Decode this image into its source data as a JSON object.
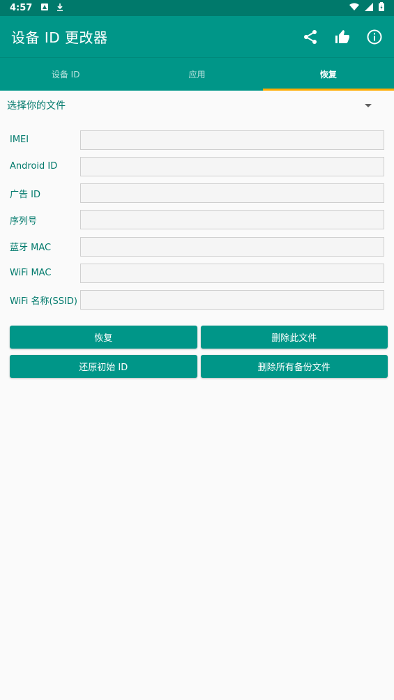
{
  "status_bar": {
    "time": "4:57"
  },
  "app_bar": {
    "title": "设备 ID 更改器"
  },
  "tabs": [
    {
      "label": "设备 ID",
      "active": false
    },
    {
      "label": "应用",
      "active": false
    },
    {
      "label": "恢复",
      "active": true
    }
  ],
  "file_selector": {
    "label": "选择你的文件"
  },
  "form": {
    "fields": [
      {
        "label": "IMEI",
        "value": ""
      },
      {
        "label": "Android ID",
        "value": ""
      },
      {
        "label": "广告 ID",
        "value": ""
      },
      {
        "label": "序列号",
        "value": ""
      },
      {
        "label": "蓝牙 MAC",
        "value": ""
      },
      {
        "label": "WiFi MAC",
        "value": ""
      },
      {
        "label": "WiFi 名称(SSID)",
        "value": ""
      }
    ]
  },
  "buttons": {
    "restore": "恢复",
    "delete_file": "删除此文件",
    "restore_original": "还原初始 ID",
    "delete_all": "删除所有备份文件"
  },
  "colors": {
    "primary": "#009688",
    "primary_dark": "#00796b",
    "accent": "#ffab00",
    "background": "#fafafa"
  }
}
